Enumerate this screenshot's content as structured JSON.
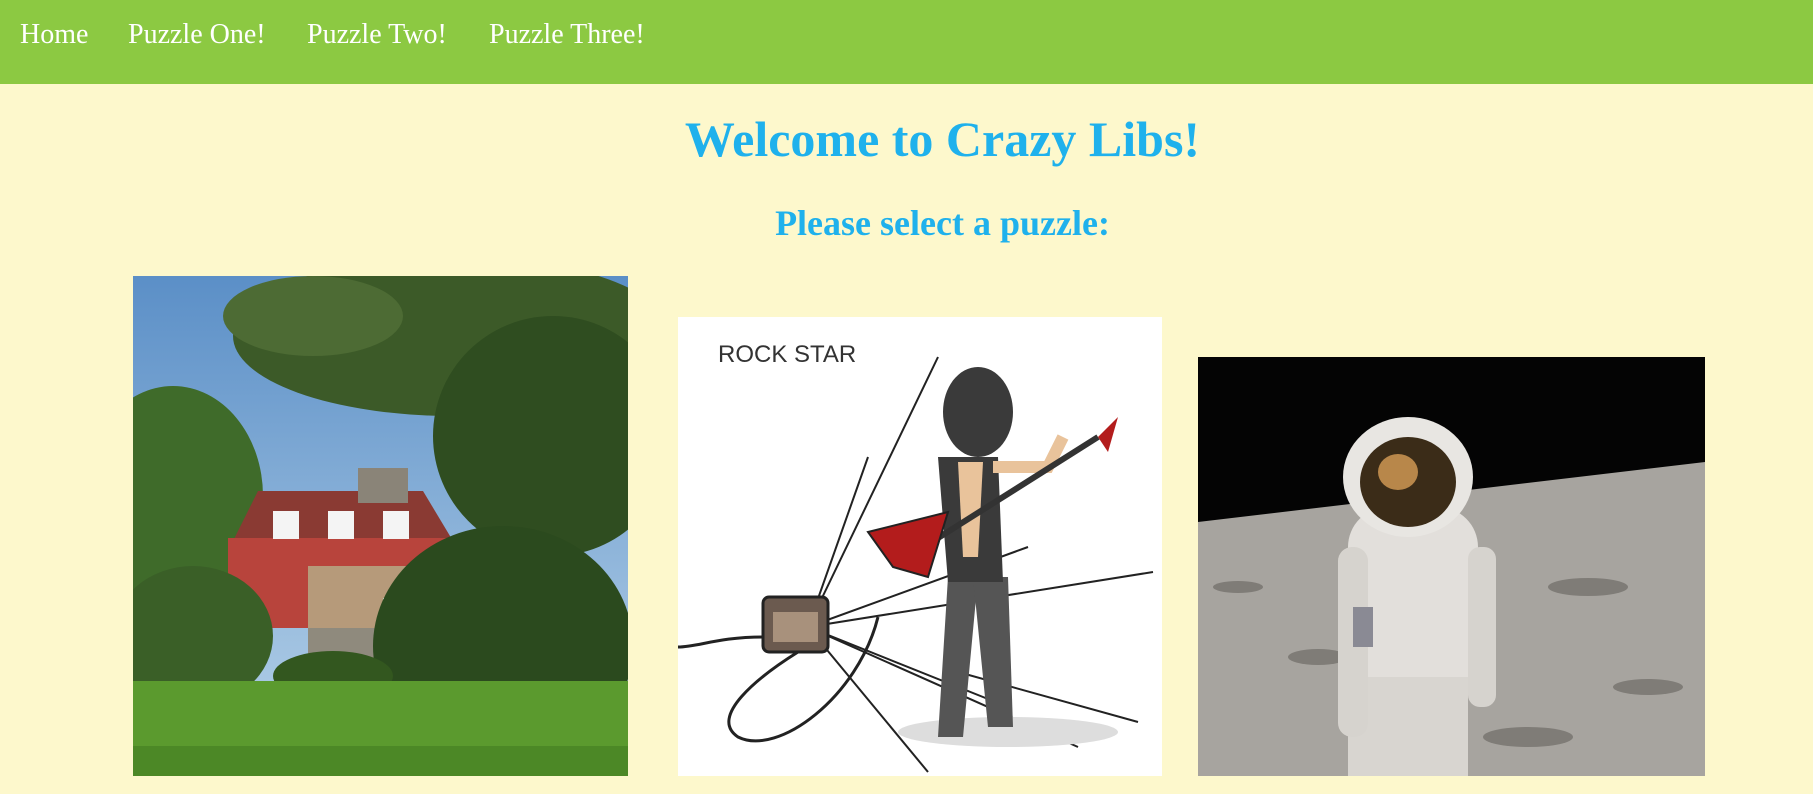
{
  "nav": {
    "items": [
      {
        "label": "Home"
      },
      {
        "label": "Puzzle One!"
      },
      {
        "label": "Puzzle Two!"
      },
      {
        "label": "Puzzle Three!"
      }
    ]
  },
  "main": {
    "title": "Welcome to Crazy Libs!",
    "subtitle": "Please select a puzzle:"
  },
  "puzzles": [
    {
      "image": "red-house-photo"
    },
    {
      "image": "rock-star-illustration",
      "caption": "ROCK STAR"
    },
    {
      "image": "astronaut-on-moon-photo"
    }
  ],
  "colors": {
    "navbar": "#8cc942",
    "background": "#fdf8cc",
    "heading": "#1fb1ec",
    "nav_text": "#ffffff"
  }
}
